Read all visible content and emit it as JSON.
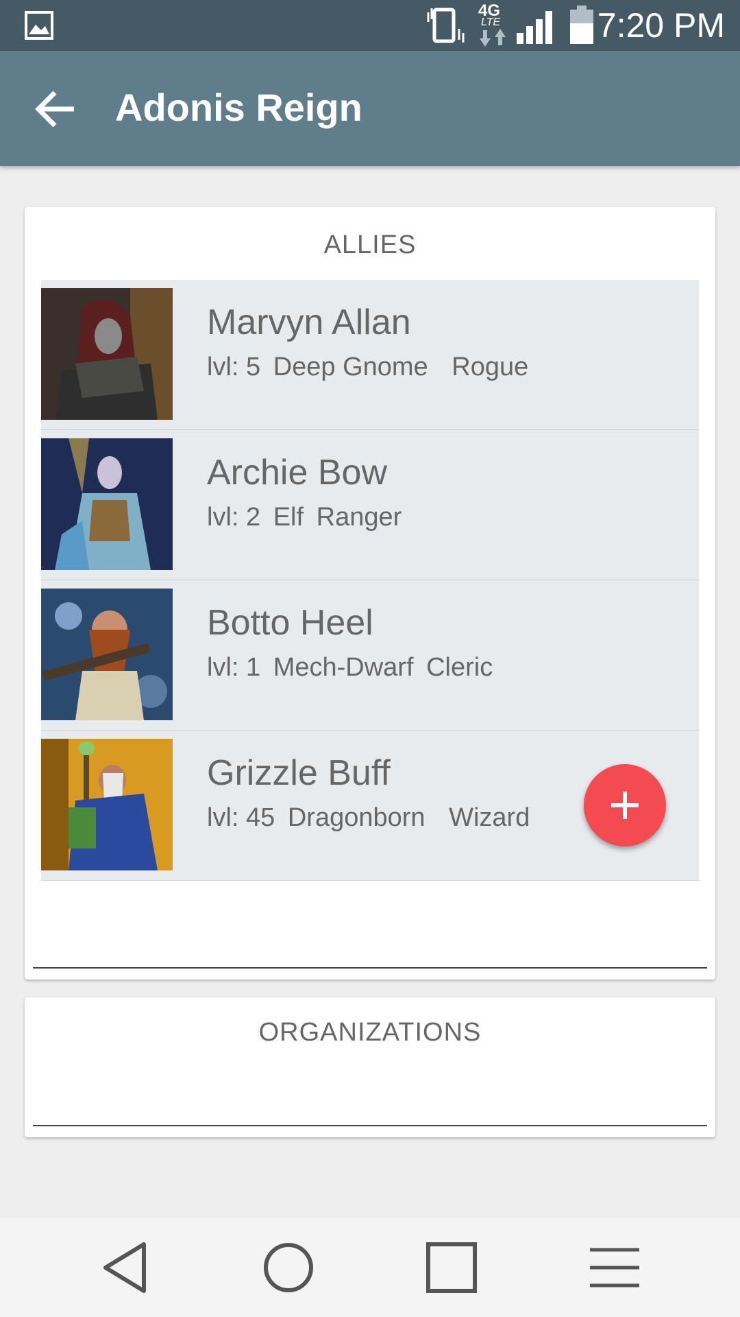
{
  "status_bar": {
    "time": "7:20 PM",
    "network": "4G",
    "network_sub": "LTE",
    "icons": [
      "gallery-icon",
      "vibrate-icon",
      "network-4g-lte-icon",
      "signal-icon",
      "battery-icon"
    ]
  },
  "app_bar": {
    "title": "Adonis Reign",
    "back_icon": "arrow-back-icon"
  },
  "allies": {
    "heading": "ALLIES",
    "items": [
      {
        "name": "Marvyn Allan",
        "level": "lvl: 5",
        "race": "Deep Gnome",
        "class": "Rogue"
      },
      {
        "name": "Archie Bow",
        "level": "lvl: 2",
        "race": "Elf",
        "class": "Ranger"
      },
      {
        "name": "Botto Heel",
        "level": "lvl: 1",
        "race": "Mech-Dwarf",
        "class": "Cleric"
      },
      {
        "name": "Grizzle Buff",
        "level": "lvl: 45",
        "race": "Dragonborn",
        "class": "Wizard"
      }
    ]
  },
  "organizations": {
    "heading": "ORGANIZATIONS"
  },
  "fab": {
    "icon": "plus-icon",
    "color": "#f44a52"
  },
  "colors": {
    "status_bar": "#455a64",
    "app_bar": "#607d8b",
    "row_bg": "#e8ebed"
  },
  "nav_bar": {
    "icons": [
      "nav-back-icon",
      "nav-home-icon",
      "nav-recents-icon",
      "nav-menu-icon"
    ]
  }
}
